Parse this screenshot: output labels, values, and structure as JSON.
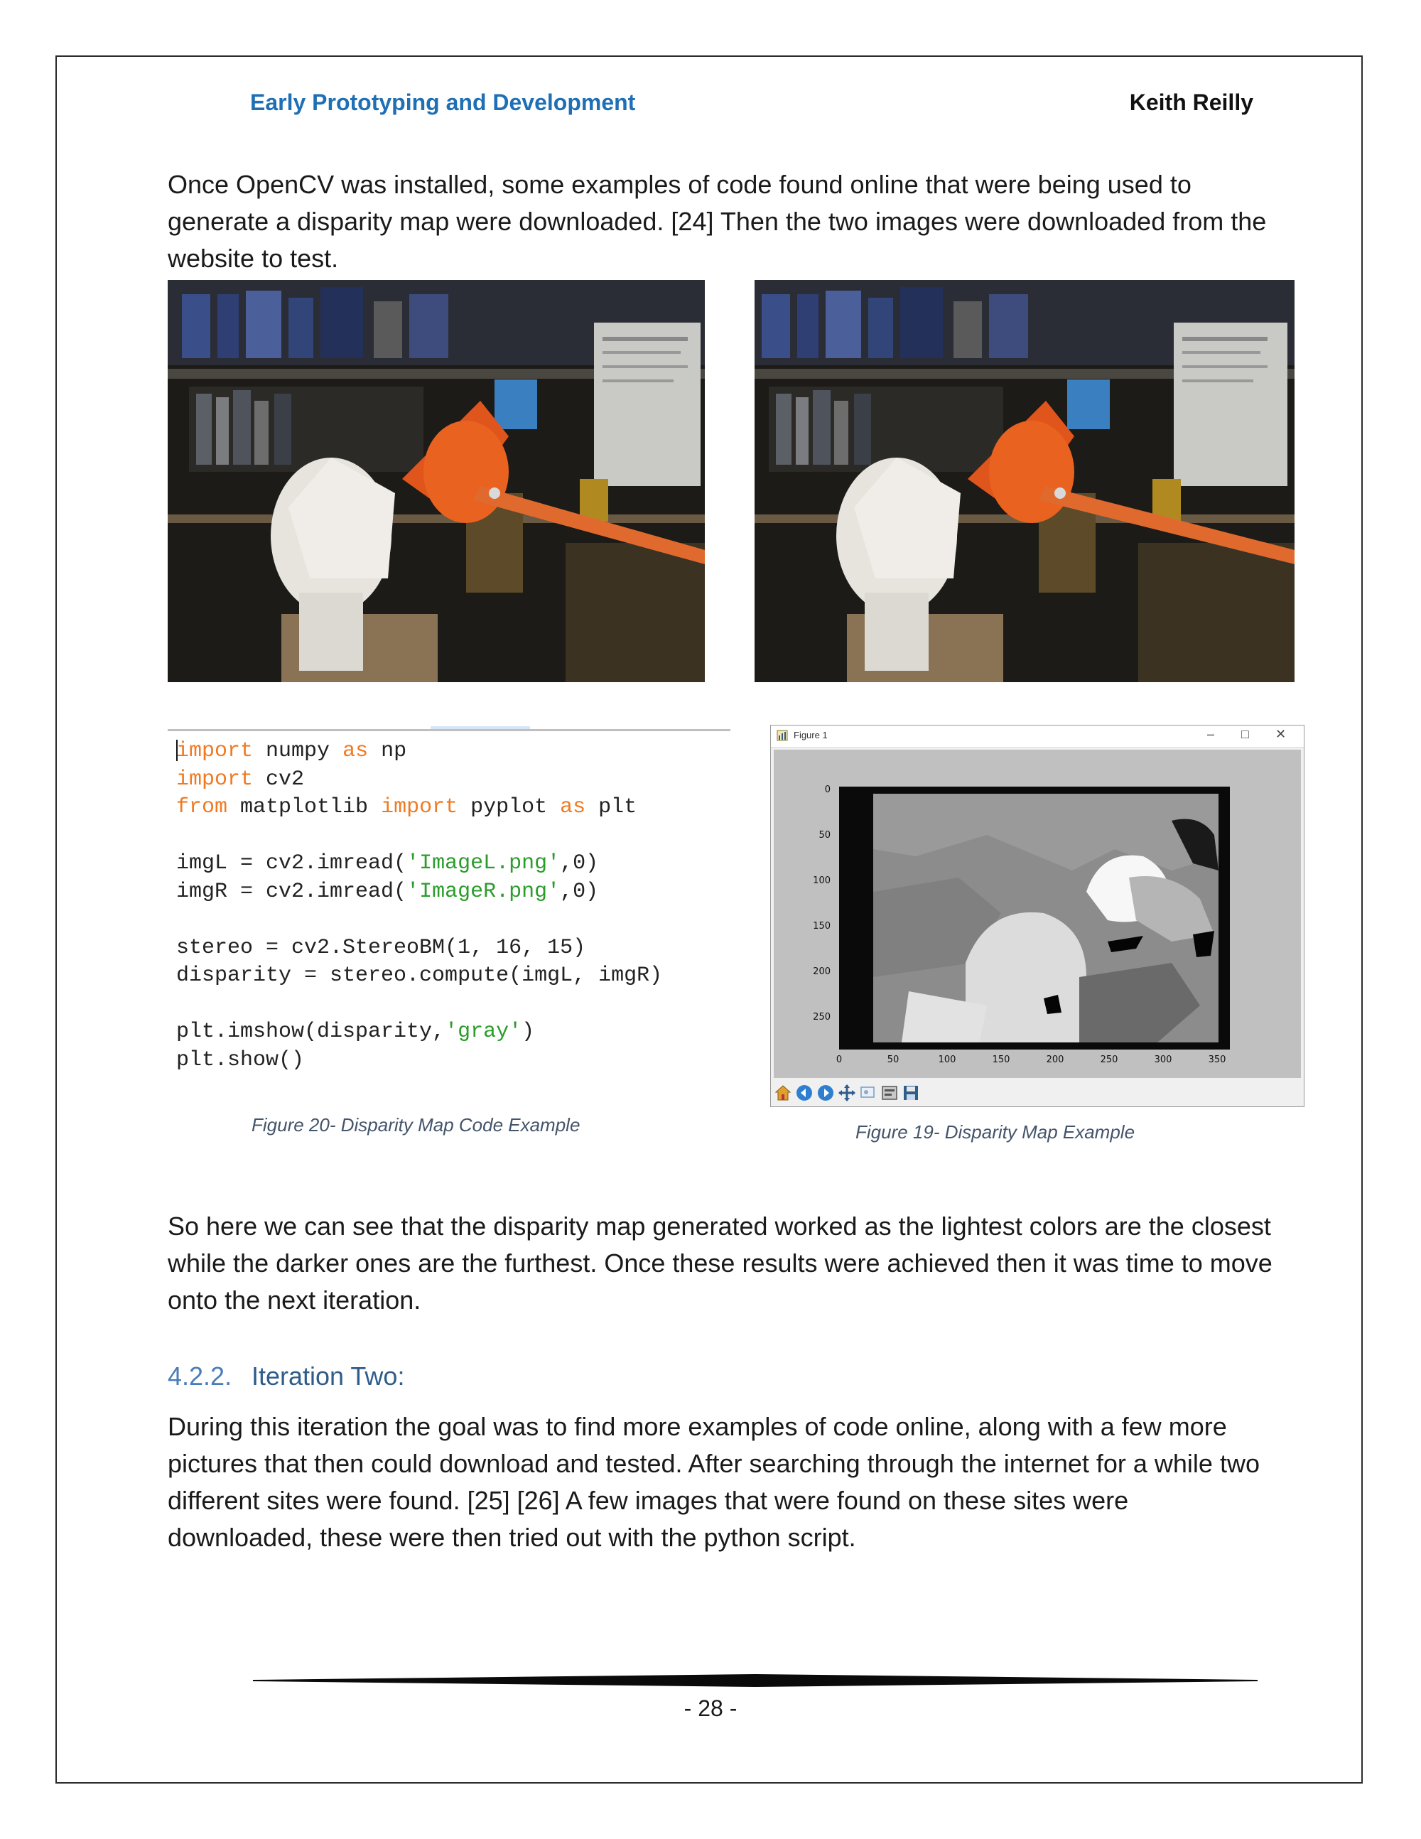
{
  "header": {
    "left": "Early Prototyping and Development",
    "right": "Keith Reilly"
  },
  "paragraphs": {
    "intro": "Once OpenCV was installed, some examples of code found online that were being used to generate a disparity map were downloaded. [24] Then the two images were downloaded from the website to test.",
    "result": "So here we can see that the disparity map generated worked as the lightest colors are the closest while the darker ones are the furthest. Once these results were achieved then it was time to move onto the next iteration.",
    "iteration_two": "During this iteration the goal was to find more examples of code online, along with a few more pictures that then could download and tested. After searching through the internet for a while two different sites were found. [25] [26] A few images that were found on these sites were downloaded, these were then tried out with the python script."
  },
  "section": {
    "number": "4.2.2.",
    "title": "Iteration Two:"
  },
  "code": {
    "line1_kw": "import",
    "line1_rest": " numpy ",
    "line1_kw2": "as",
    "line1_rest2": " np",
    "line2_kw": "import",
    "line2_rest": " cv2",
    "line3_kw": "from",
    "line3_rest": " matplotlib ",
    "line3_kw2": "import",
    "line3_rest2": " pyplot ",
    "line3_kw3": "as",
    "line3_rest3": " plt",
    "line5_pre": "imgL = cv2.imread(",
    "line5_str": "'ImageL.png'",
    "line5_post": ",0)",
    "line6_pre": "imgR = cv2.imread(",
    "line6_str": "'ImageR.png'",
    "line6_post": ",0)",
    "line8": "stereo = cv2.StereoBM(1, 16, 15)",
    "line9": "disparity = stereo.compute(imgL, imgR)",
    "line11_pre": "plt.imshow(disparity,",
    "line11_str": "'gray'",
    "line11_post": ")",
    "line12": "plt.show()"
  },
  "figure_window": {
    "title": "Figure 1",
    "minimize": "–",
    "maximize": "□",
    "close": "✕",
    "y_ticks": [
      "0",
      "50",
      "100",
      "150",
      "200",
      "250"
    ],
    "x_ticks": [
      "0",
      "50",
      "100",
      "150",
      "200",
      "250",
      "300",
      "350"
    ],
    "toolbar_icons": [
      "home-icon",
      "back-icon",
      "forward-icon",
      "pan-icon",
      "zoom-icon",
      "configure-icon",
      "save-icon"
    ]
  },
  "captions": {
    "code": "Figure 20- Disparity Map Code Example",
    "map": "Figure 19- Disparity Map Example"
  },
  "footer": {
    "page_number": "- 28 -"
  },
  "colors": {
    "header_blue": "#1f6fb5",
    "section_blue": "#2f5d8a",
    "keyword_orange": "#f07a22",
    "string_green": "#2a9d2a",
    "caption_gray": "#44546a"
  }
}
